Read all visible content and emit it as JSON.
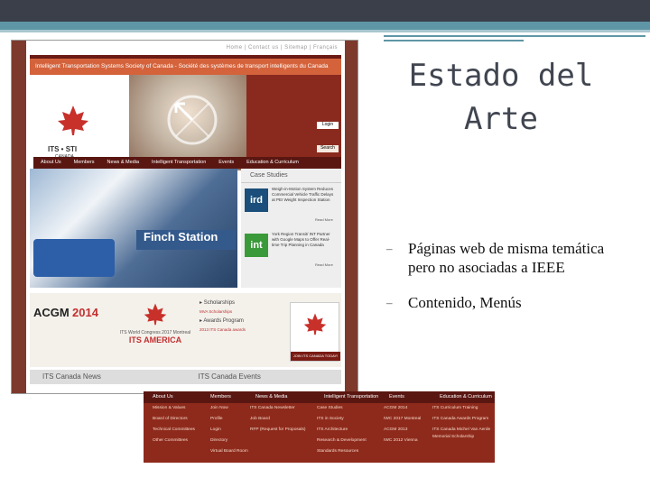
{
  "slide": {
    "title": "Estado del Arte",
    "bullets": [
      "Páginas web de misma temática pero no asociadas a IEEE",
      "Contenido, Menús"
    ]
  },
  "site": {
    "top_links": "Home | Contact us | Sitemap | Français",
    "header_title": "Intelligent Transportation Systems Society of Canada  -  Société des systèmes de transport intelligents du Canada",
    "logo_text": "ITS • STI",
    "logo_sub": "CANADA",
    "login_label": "Login",
    "search_label": "Search",
    "nav": [
      "About Us",
      "Members",
      "News & Media",
      "Intelligent Transportation",
      "Events",
      "Education & Curriculum"
    ],
    "hero_sign": "Finch Station",
    "case_studies_title": "Case Studies",
    "case_items": [
      {
        "logo": "ird",
        "text": "Weigh-in-Motion System Reduces Commercial Vehicle Traffic Delays at PEI Weight Inspection Station",
        "more": "Read More"
      },
      {
        "logo": "int",
        "text": "York Region Transit/ INT Partner with Google Maps to Offer Real-time Trip Planning in Canada",
        "more": "Read More"
      }
    ],
    "acgm": "ACGM",
    "acgm_year": "2014",
    "world_congress": "ITS World Congress 2017 Montreal",
    "its_america": "ITS AMERICA",
    "promo_list": [
      {
        "title": "Scholarships",
        "sub": "MVA Scholarships"
      },
      {
        "title": "Awards Program",
        "sub": "2013 ITS Canada awards"
      }
    ],
    "join_label": "JOIN ITS CANADA TODAY!",
    "news_title": "ITS Canada News",
    "events_title": "ITS Canada Events"
  },
  "menu": {
    "headers": [
      "About Us",
      "Members",
      "News & Media",
      "Intelligent Transportation",
      "Events",
      "Education & Curriculum"
    ],
    "columns": [
      [
        "Mission & Values",
        "Board of Directors",
        "Technical Committees",
        "Other Committees"
      ],
      [
        "Join Now",
        "Profile",
        "Login",
        "Directory",
        "Virtual Board Room"
      ],
      [
        "ITS Canada Newsletter",
        "Job Board",
        "RFP (Request for Proposals)"
      ],
      [
        "Case Studies",
        "ITS in Society",
        "ITS Architecture",
        "Research & Development",
        "Standards Resources"
      ],
      [
        "ACGM 2014",
        "IWC 2017 Montreal",
        "ACGM 2013",
        "IWC 2012 Vienna"
      ],
      [
        "ITS Curriculum Training",
        "ITS Canada Awards Program",
        "ITS Canada Michel Van Aerde Memorial Scholarship"
      ]
    ]
  }
}
